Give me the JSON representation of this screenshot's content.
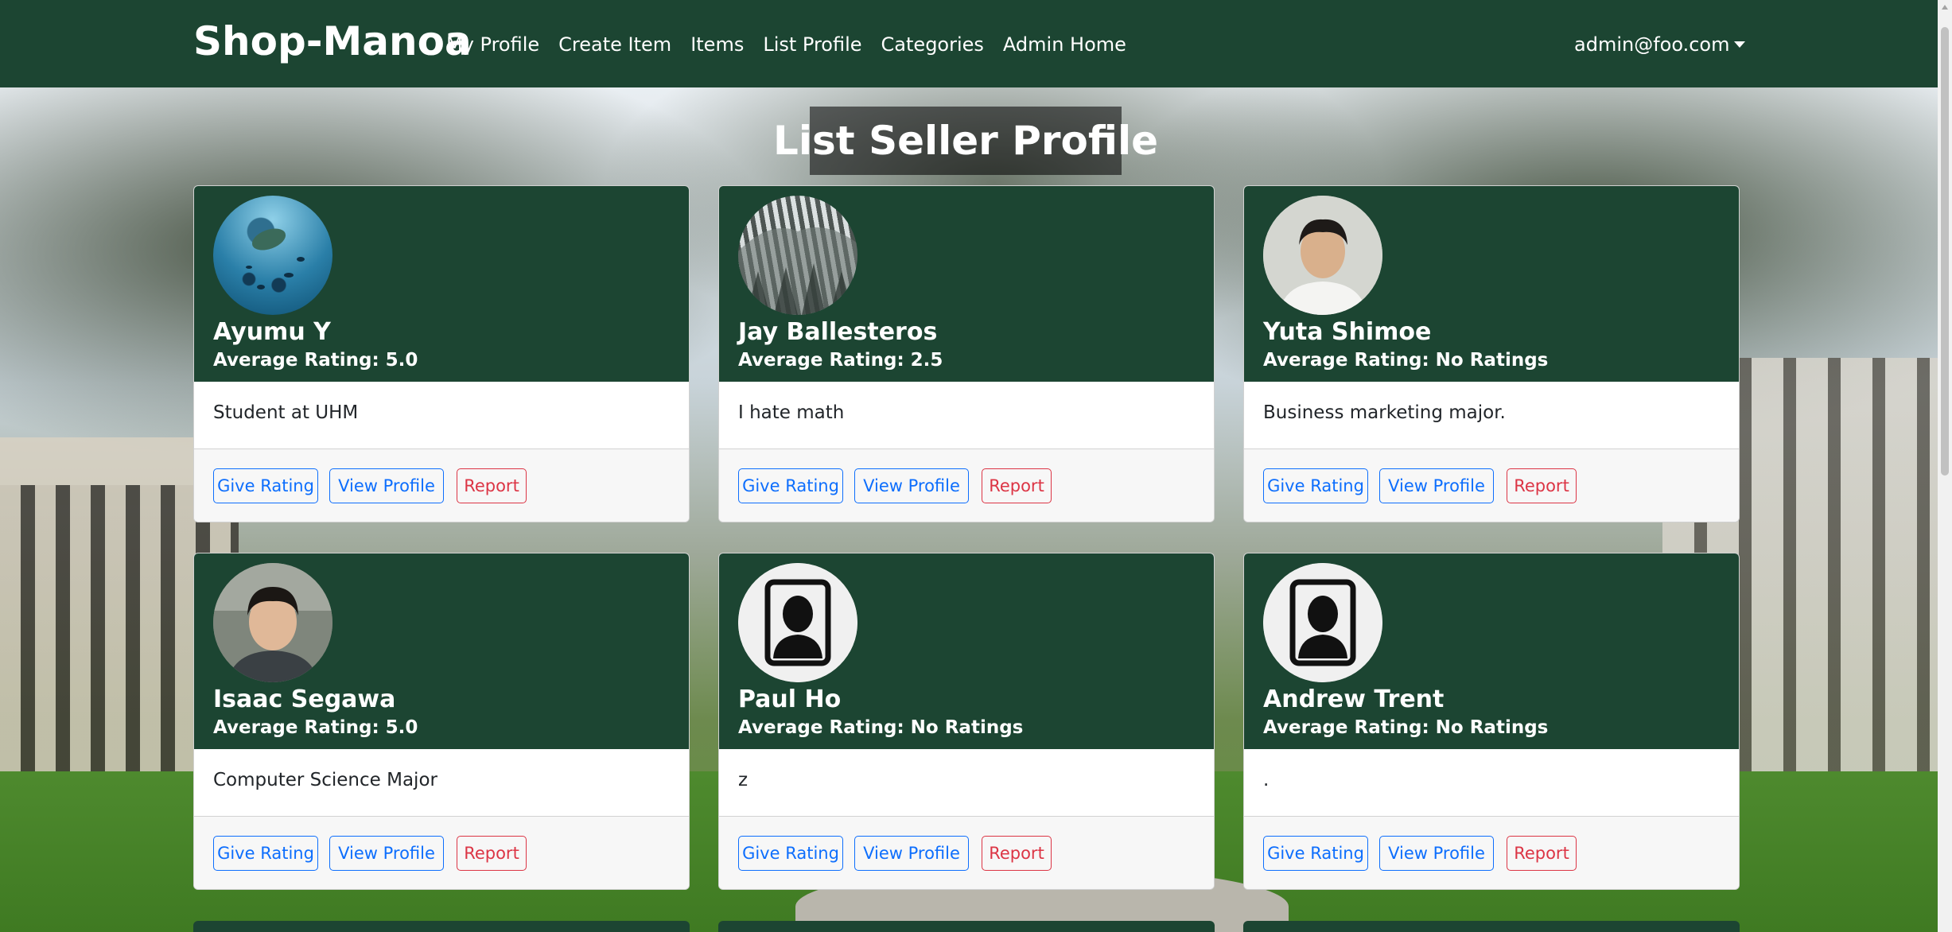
{
  "navbar": {
    "brand": "Shop-Manoa",
    "links": [
      {
        "label": "My Profile"
      },
      {
        "label": "Create Item"
      },
      {
        "label": "Items"
      },
      {
        "label": "List Profile"
      },
      {
        "label": "Categories"
      },
      {
        "label": "Admin Home"
      }
    ],
    "user": "admin@foo.com"
  },
  "page": {
    "title": "List Seller Profile"
  },
  "card_buttons": {
    "rate": "Give Rating",
    "view": "View Profile",
    "report": "Report"
  },
  "sellers": [
    {
      "name": "Ayumu Y",
      "rating": "Average Rating: 5.0",
      "bio": "Student at UHM",
      "avatar": "ocean-photo"
    },
    {
      "name": "Jay Ballesteros",
      "rating": "Average Rating: 2.5",
      "bio": "I hate math",
      "avatar": "snowy-forest-photo"
    },
    {
      "name": "Yuta Shimoe",
      "rating": "Average Rating: No Ratings",
      "bio": "Business marketing major.",
      "avatar": "person-photo"
    },
    {
      "name": "Isaac Segawa",
      "rating": "Average Rating: 5.0",
      "bio": "Computer Science Major",
      "avatar": "person-photo"
    },
    {
      "name": "Paul Ho",
      "rating": "Average Rating: No Ratings",
      "bio": "z",
      "avatar": "default-avatar-icon"
    },
    {
      "name": "Andrew Trent",
      "rating": "Average Rating: No Ratings",
      "bio": ".",
      "avatar": "default-avatar-icon"
    }
  ],
  "colors": {
    "navbar": "#1c4532",
    "card_header": "#1c4532",
    "primary_outline": "#0d6efd",
    "danger_outline": "#dc3545"
  }
}
